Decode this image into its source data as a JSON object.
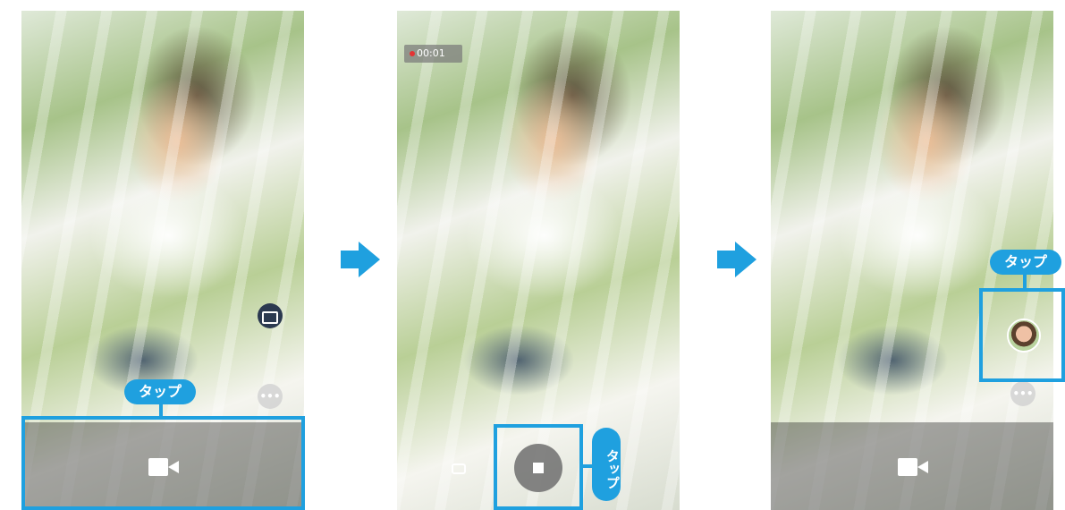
{
  "tap_label": "タップ",
  "screen2": {
    "recording_timer": "00:01"
  },
  "icons": {
    "video": "video-camera-icon",
    "camera": "camera-icon",
    "stop": "stop-icon",
    "gallery": "gallery-icon",
    "more": "more-icon",
    "thumbnail": "thumbnail-icon",
    "arrow": "arrow-right-icon"
  },
  "colors": {
    "accent": "#1fa0df",
    "record_dot": "#e43434"
  },
  "more_glyph": "•••"
}
